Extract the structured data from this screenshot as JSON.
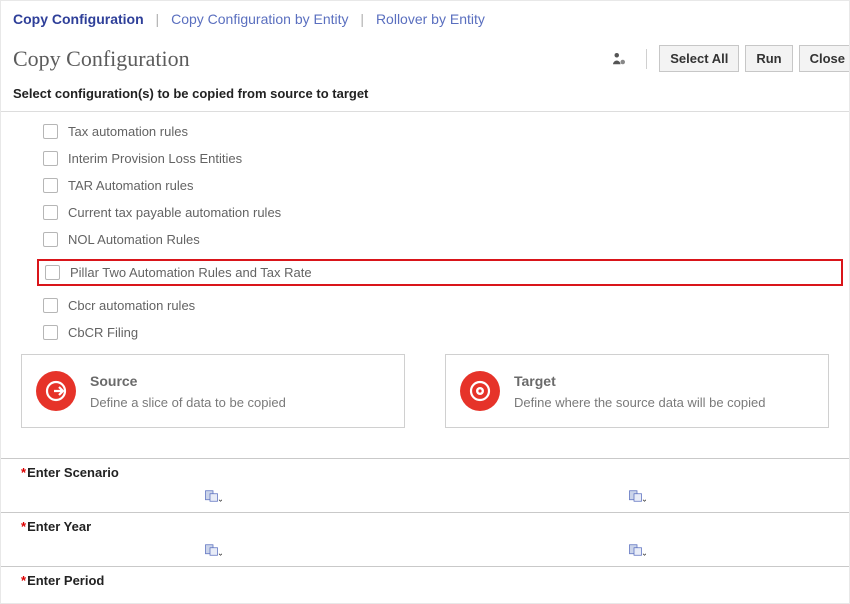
{
  "tabs": {
    "copy_config": "Copy Configuration",
    "copy_by_entity": "Copy Configuration by Entity",
    "rollover": "Rollover by Entity"
  },
  "page_title": "Copy Configuration",
  "actions": {
    "select_all": "Select All",
    "run": "Run",
    "close": "Close"
  },
  "instruction": "Select configuration(s) to be copied from source to target",
  "config_items": [
    "Tax automation rules",
    "Interim Provision Loss Entities",
    "TAR Automation rules",
    "Current tax payable automation rules",
    "NOL Automation Rules",
    "Pillar Two Automation Rules and Tax Rate",
    "Cbcr automation rules",
    "CbCR Filing"
  ],
  "source": {
    "title": "Source",
    "sub": "Define a slice of data to be copied"
  },
  "target": {
    "title": "Target",
    "sub": "Define where the source data will be copied"
  },
  "fields": {
    "scenario": "Enter Scenario",
    "year": "Enter Year",
    "period": "Enter Period"
  }
}
